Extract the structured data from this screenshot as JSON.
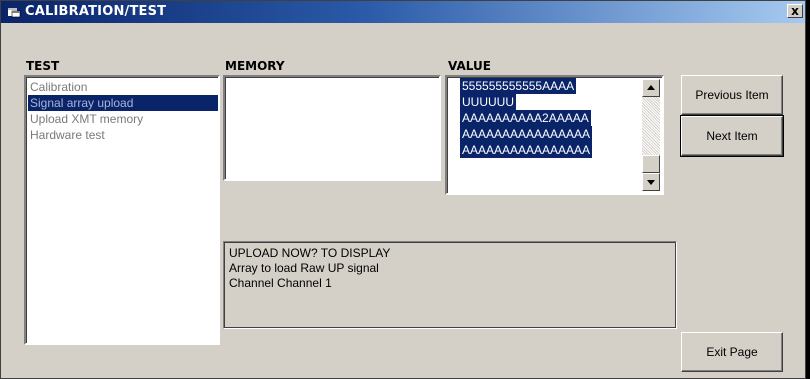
{
  "window": {
    "title": "CALIBRATION/TEST",
    "close_label": "x"
  },
  "test": {
    "header": "TEST",
    "items": [
      {
        "label": "Calibration",
        "selected": false
      },
      {
        "label": "Signal array upload",
        "selected": true
      },
      {
        "label": "Upload XMT memory",
        "selected": false
      },
      {
        "label": "Hardware test",
        "selected": false
      }
    ]
  },
  "memory": {
    "header": "MEMORY"
  },
  "value": {
    "header": "VALUE",
    "lines": [
      "555555555555AAAA",
      "UUUUUU",
      "AAAAAAAAAA2AAAAA",
      "AAAAAAAAAAAAAAAA",
      "AAAAAAAAAAAAAAAA"
    ]
  },
  "status": {
    "lines": [
      "UPLOAD NOW?   TO DISPLAY",
      "Array to load   Raw UP signal",
      "Channel   Channel 1"
    ]
  },
  "buttons": {
    "previous": "Previous Item",
    "next": "Next Item",
    "exit": "Exit Page"
  },
  "colors": {
    "face": "#d4d0c8",
    "selection": "#0a246a",
    "title_start": "#0a246a",
    "title_end": "#a6caf0"
  },
  "icons": {
    "title": "app-window-icon",
    "close": "close-icon",
    "scroll_up": "scroll-up-arrow-icon",
    "scroll_down": "scroll-down-arrow-icon"
  }
}
